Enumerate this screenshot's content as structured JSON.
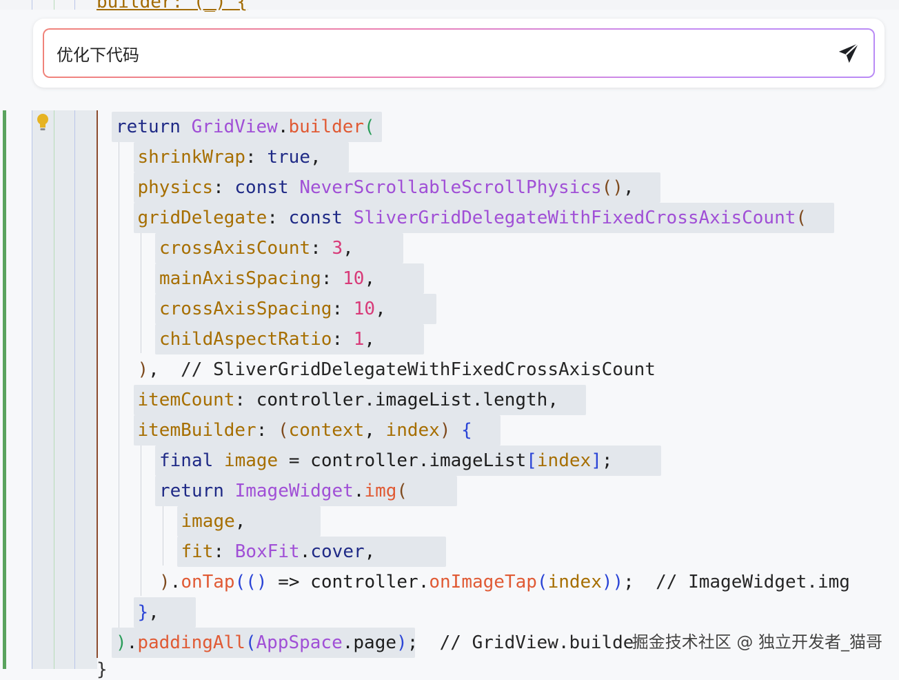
{
  "prompt": {
    "placeholder": "",
    "value": "优化下代码",
    "send_icon": "paper-plane-icon"
  },
  "colors": {
    "keyword": "#1f2a86",
    "class": "#a04fd6",
    "function": "#e05a34",
    "property": "#a66e00",
    "number": "#d83a78",
    "vcs_added": "#5aa35e",
    "gradient_start": "#f0837a",
    "gradient_end": "#b98af5"
  },
  "editor": {
    "lines": [
      [
        [
          "kw",
          "return"
        ],
        [
          "id",
          " "
        ],
        [
          "cls",
          "GridView"
        ],
        [
          "id",
          "."
        ],
        [
          "fn",
          "builder"
        ],
        [
          "p1",
          "("
        ]
      ],
      [
        [
          "prop",
          "shrinkWrap"
        ],
        [
          "id",
          ": "
        ],
        [
          "kw",
          "true"
        ],
        [
          "id",
          ","
        ]
      ],
      [
        [
          "prop",
          "physics"
        ],
        [
          "id",
          ": "
        ],
        [
          "kw",
          "const"
        ],
        [
          "id",
          " "
        ],
        [
          "cls",
          "NeverScrollableScrollPhysics"
        ],
        [
          "p2",
          "()"
        ],
        [
          "id",
          ","
        ]
      ],
      [
        [
          "prop",
          "gridDelegate"
        ],
        [
          "id",
          ": "
        ],
        [
          "kw",
          "const"
        ],
        [
          "id",
          " "
        ],
        [
          "cls",
          "SliverGridDelegateWithFixedCrossAxisCount"
        ],
        [
          "p2",
          "("
        ]
      ],
      [
        [
          "prop",
          "crossAxisCount"
        ],
        [
          "id",
          ": "
        ],
        [
          "num",
          "3"
        ],
        [
          "id",
          ","
        ]
      ],
      [
        [
          "prop",
          "mainAxisSpacing"
        ],
        [
          "id",
          ": "
        ],
        [
          "num",
          "10"
        ],
        [
          "id",
          ","
        ]
      ],
      [
        [
          "prop",
          "crossAxisSpacing"
        ],
        [
          "id",
          ": "
        ],
        [
          "num",
          "10"
        ],
        [
          "id",
          ","
        ]
      ],
      [
        [
          "prop",
          "childAspectRatio"
        ],
        [
          "id",
          ": "
        ],
        [
          "num",
          "1"
        ],
        [
          "id",
          ","
        ]
      ],
      [
        [
          "p2",
          ")"
        ],
        [
          "id",
          ",  "
        ],
        [
          "cm",
          "// SliverGridDelegateWithFixedCrossAxisCount"
        ]
      ],
      [
        [
          "prop",
          "itemCount"
        ],
        [
          "id",
          ": controller.imageList.length,"
        ]
      ],
      [
        [
          "prop",
          "itemBuilder"
        ],
        [
          "id",
          ": "
        ],
        [
          "p2",
          "("
        ],
        [
          "prop",
          "context"
        ],
        [
          "id",
          ", "
        ],
        [
          "prop",
          "index"
        ],
        [
          "p2",
          ")"
        ],
        [
          "id",
          " "
        ],
        [
          "p3",
          "{"
        ]
      ],
      [
        [
          "kw",
          "final"
        ],
        [
          "id",
          " "
        ],
        [
          "prop",
          "image"
        ],
        [
          "id",
          " = controller.imageList"
        ],
        [
          "p3",
          "["
        ],
        [
          "prop",
          "index"
        ],
        [
          "p3",
          "]"
        ],
        [
          "id",
          ";"
        ]
      ],
      [
        [
          "kw",
          "return"
        ],
        [
          "id",
          " "
        ],
        [
          "cls",
          "ImageWidget"
        ],
        [
          "id",
          "."
        ],
        [
          "fn",
          "img"
        ],
        [
          "p2",
          "("
        ]
      ],
      [
        [
          "prop",
          "image"
        ],
        [
          "id",
          ","
        ]
      ],
      [
        [
          "prop",
          "fit"
        ],
        [
          "id",
          ": "
        ],
        [
          "cls",
          "BoxFit"
        ],
        [
          "id",
          "."
        ],
        [
          "kw",
          "cover"
        ],
        [
          "id",
          ","
        ]
      ],
      [
        [
          "p2",
          ")"
        ],
        [
          "id",
          "."
        ],
        [
          "fn",
          "onTap"
        ],
        [
          "p3",
          "(()"
        ],
        [
          "id",
          " => controller."
        ],
        [
          "fn",
          "onImageTap"
        ],
        [
          "p3",
          "("
        ],
        [
          "prop",
          "index"
        ],
        [
          "p3",
          "))"
        ],
        [
          "id",
          ";  "
        ],
        [
          "cm",
          "// ImageWidget.img"
        ]
      ],
      [
        [
          "p3",
          "}"
        ],
        [
          "id",
          ","
        ]
      ],
      [
        [
          "p1",
          ")"
        ],
        [
          "id",
          "."
        ],
        [
          "fn",
          "paddingAll"
        ],
        [
          "p3",
          "("
        ],
        [
          "cls",
          "AppSpace"
        ],
        [
          "id",
          "."
        ],
        [
          "id",
          "page"
        ],
        [
          "p3",
          ")"
        ],
        [
          "id",
          ";  "
        ],
        [
          "cm",
          "// GridView.builder"
        ]
      ]
    ]
  },
  "watermark": "掘金技术社区 @ 独立开发者_猫哥",
  "top_cut_text": "builder: (_) {",
  "closing_brace": "}"
}
